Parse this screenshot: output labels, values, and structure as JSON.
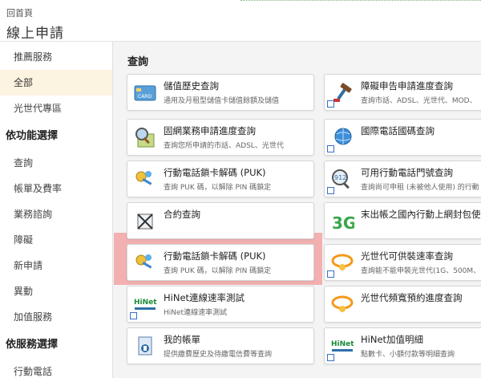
{
  "header": {
    "back_label": "回首頁",
    "title": "線上申請"
  },
  "sidebar": {
    "items": [
      {
        "label": "推薦服務"
      },
      {
        "label": "全部"
      },
      {
        "label": "光世代專區"
      }
    ],
    "group_function": {
      "title": "依功能選擇",
      "items": [
        {
          "label": "查詢"
        },
        {
          "label": "帳單及費率"
        },
        {
          "label": "業務諮詢"
        },
        {
          "label": "障礙"
        },
        {
          "label": "新申請"
        },
        {
          "label": "異動"
        },
        {
          "label": "加值服務"
        }
      ]
    },
    "group_service": {
      "title": "依服務選擇",
      "items": [
        {
          "label": "行動電話"
        }
      ]
    }
  },
  "main": {
    "section_title": "查詢",
    "cards": [
      {
        "title": "儲值歷史查詢",
        "desc": "通用及月租型儲值卡儲值餘額及儲值",
        "icon": "card-icon"
      },
      {
        "title": "障礙申告申請進度查詢",
        "desc": "查詢市話、ADSL、光世代、MOD、",
        "icon": "tools-icon"
      },
      {
        "title": "固網業務申請進度查詢",
        "desc": "查詢您所申請的市話、ADSL、光世代",
        "icon": "magnifier-icon"
      },
      {
        "title": "國際電話國碼查詢",
        "desc": "",
        "icon": "globe-icon"
      },
      {
        "title": "行動電話鎖卡解碼 (PUK)",
        "desc": "查詢 PUK 碼，以解除 PIN 碼鎖定",
        "icon": "keys-icon"
      },
      {
        "title": "可用行動電話門號查詢",
        "desc": "查詢尚可申租 (未被他人使用) 的行動",
        "icon": "number-search-icon"
      },
      {
        "title": "合約查詢",
        "desc": "",
        "icon": "contract-icon"
      },
      {
        "title": "末出帳之國內行動上網封包使用",
        "desc": "",
        "icon": "3g-icon"
      },
      {
        "title": "行動電話鎖卡解碼 (PUK)",
        "desc": "查詢 PUK 碼，以解除 PIN 碼鎖定",
        "icon": "keys-icon"
      },
      {
        "title": "光世代可供裝速率查詢",
        "desc": "查詢能不能申裝光世代(1G、500M、",
        "icon": "fiber-icon"
      },
      {
        "title": "HiNet連線速率測試",
        "desc": "HiNet連線速率測試",
        "icon": "hinet-icon"
      },
      {
        "title": "光世代頻寬預約進度查詢",
        "desc": "",
        "icon": "fiber-icon"
      },
      {
        "title": "我的帳單",
        "desc": "提供繳費歷史及待繳電信費等查詢",
        "icon": "bill-icon"
      },
      {
        "title": "HiNet加值明細",
        "desc": "點數卡、小額付款等明細查詢",
        "icon": "hinet-icon"
      }
    ]
  }
}
